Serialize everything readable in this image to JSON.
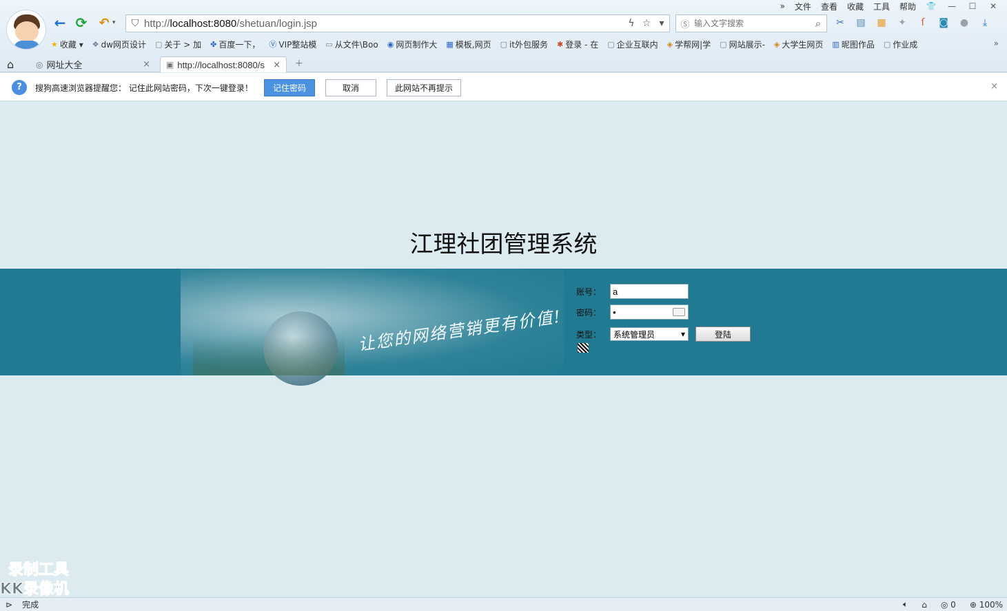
{
  "browser": {
    "top_menu": [
      "»",
      "文件",
      "查看",
      "收藏",
      "工具",
      "帮助"
    ],
    "window_buttons": {
      "skin": "👕",
      "minimize": "—",
      "maximize": "☐",
      "close": "✕"
    },
    "address": {
      "prefix": "http://",
      "host": "localhost:8080",
      "path": "/shetuan/login.jsp"
    },
    "search_placeholder": "输入文字搜索",
    "favorites": [
      {
        "icon": "★",
        "label": "收藏 ▾"
      },
      {
        "icon": "❖",
        "label": "dw网页设计"
      },
      {
        "icon": "▢",
        "label": "关于 > 加"
      },
      {
        "icon": "✤",
        "label": "百度一下，"
      },
      {
        "icon": "Ⓥ",
        "label": "VIP整站模"
      },
      {
        "icon": "▭",
        "label": "从文件\\Boo"
      },
      {
        "icon": "◉",
        "label": "网页制作大"
      },
      {
        "icon": "▦",
        "label": "模板,网页"
      },
      {
        "icon": "▢",
        "label": "it外包服务"
      },
      {
        "icon": "✱",
        "label": "登录 - 在"
      },
      {
        "icon": "▢",
        "label": "企业互联内"
      },
      {
        "icon": "◈",
        "label": "学帮网|学"
      },
      {
        "icon": "▢",
        "label": "网站展示-"
      },
      {
        "icon": "◈",
        "label": "大学生网页"
      },
      {
        "icon": "▥",
        "label": "昵图作品"
      },
      {
        "icon": "▢",
        "label": "作业成"
      }
    ],
    "favorites_more": "»",
    "tabs": [
      {
        "label": "网址大全",
        "icon": "◎"
      },
      {
        "label": "http://localhost:8080/s",
        "icon": "▣"
      }
    ],
    "new_tab": "+"
  },
  "password_prompt": {
    "message": "搜狗高速浏览器提醒您： 记住此网站密码，下次一键登录！",
    "remember_label": "记住密码",
    "cancel_label": "取消",
    "never_label": "此网站不再提示",
    "close": "×"
  },
  "page": {
    "title": "江理社团管理系统",
    "slogan": "让您的网络营销更有价值!",
    "form": {
      "account_label": "账号：",
      "account_value": "a",
      "password_label": "密码：",
      "password_value": "•",
      "type_label": "类型：",
      "type_selected": "系统管理员",
      "login_label": "登陆"
    }
  },
  "watermark": {
    "line1": "录制工具",
    "line2": "KK录像机"
  },
  "status_bar": {
    "status_text": "完成",
    "counter": "0",
    "zoom": "100%"
  }
}
